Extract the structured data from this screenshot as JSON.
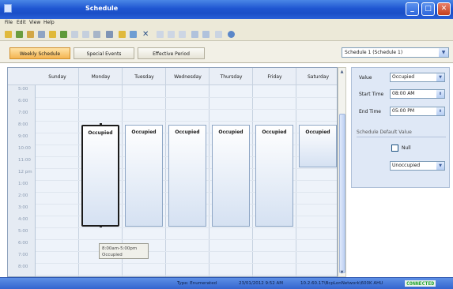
{
  "window": {
    "title": "Schedule"
  },
  "menu": [
    "File",
    "Edit",
    "View",
    "Help"
  ],
  "tabs": [
    {
      "label": "Weekly Schedule",
      "active": true
    },
    {
      "label": "Special Events",
      "active": false
    },
    {
      "label": "Effective Period",
      "active": false
    }
  ],
  "schedule_selector": {
    "value": "Schedule 1 (Schedule 1)"
  },
  "calendar": {
    "days": [
      "Sunday",
      "Monday",
      "Tuesday",
      "Wednesday",
      "Thursday",
      "Friday",
      "Saturday"
    ],
    "times": [
      "5:00",
      "6:00",
      "7:00",
      "8:00",
      "9:00",
      "10:00",
      "11:00",
      "12 pm",
      "1:00",
      "2:00",
      "3:00",
      "4:00",
      "5:00",
      "6:00",
      "7:00",
      "8:00"
    ],
    "events": [
      {
        "day": "Monday",
        "label": "Occupied",
        "start": "8:00am",
        "end": "5:00pm",
        "selected": true
      },
      {
        "day": "Tuesday",
        "label": "Occupied",
        "start": "8:00am",
        "end": "5:00pm",
        "selected": false
      },
      {
        "day": "Wednesday",
        "label": "Occupied",
        "start": "8:00am",
        "end": "5:00pm",
        "selected": false
      },
      {
        "day": "Thursday",
        "label": "Occupied",
        "start": "8:00am",
        "end": "5:00pm",
        "selected": false
      },
      {
        "day": "Friday",
        "label": "Occupied",
        "start": "8:00am",
        "end": "5:00pm",
        "selected": false
      },
      {
        "day": "Saturday",
        "label": "Occupied",
        "start": "8:00am",
        "end": "12 pm",
        "selected": false
      }
    ],
    "tooltip": {
      "line1": "8:00am-5:00pm",
      "line2": "Occupied"
    }
  },
  "properties": {
    "value_label": "Value",
    "value": "Occupied",
    "start_label": "Start Time",
    "start_time": "08:00 AM",
    "end_label": "End Time",
    "end_time": "05:00 PM",
    "default_section": "Schedule Default Value",
    "null_label": "Null",
    "default_value": "Unoccupied"
  },
  "status": {
    "type": "Type: Enumerated",
    "timestamp": "23/01/2012 9:52 AM",
    "path": "10.2.60.17\\BcpLonNetwork\\600K AHU",
    "connection": "CONNECTED"
  },
  "colors": {
    "titlebar": "#1f56d1",
    "tab_active": "#f4b451",
    "connected": "#18a02a"
  }
}
